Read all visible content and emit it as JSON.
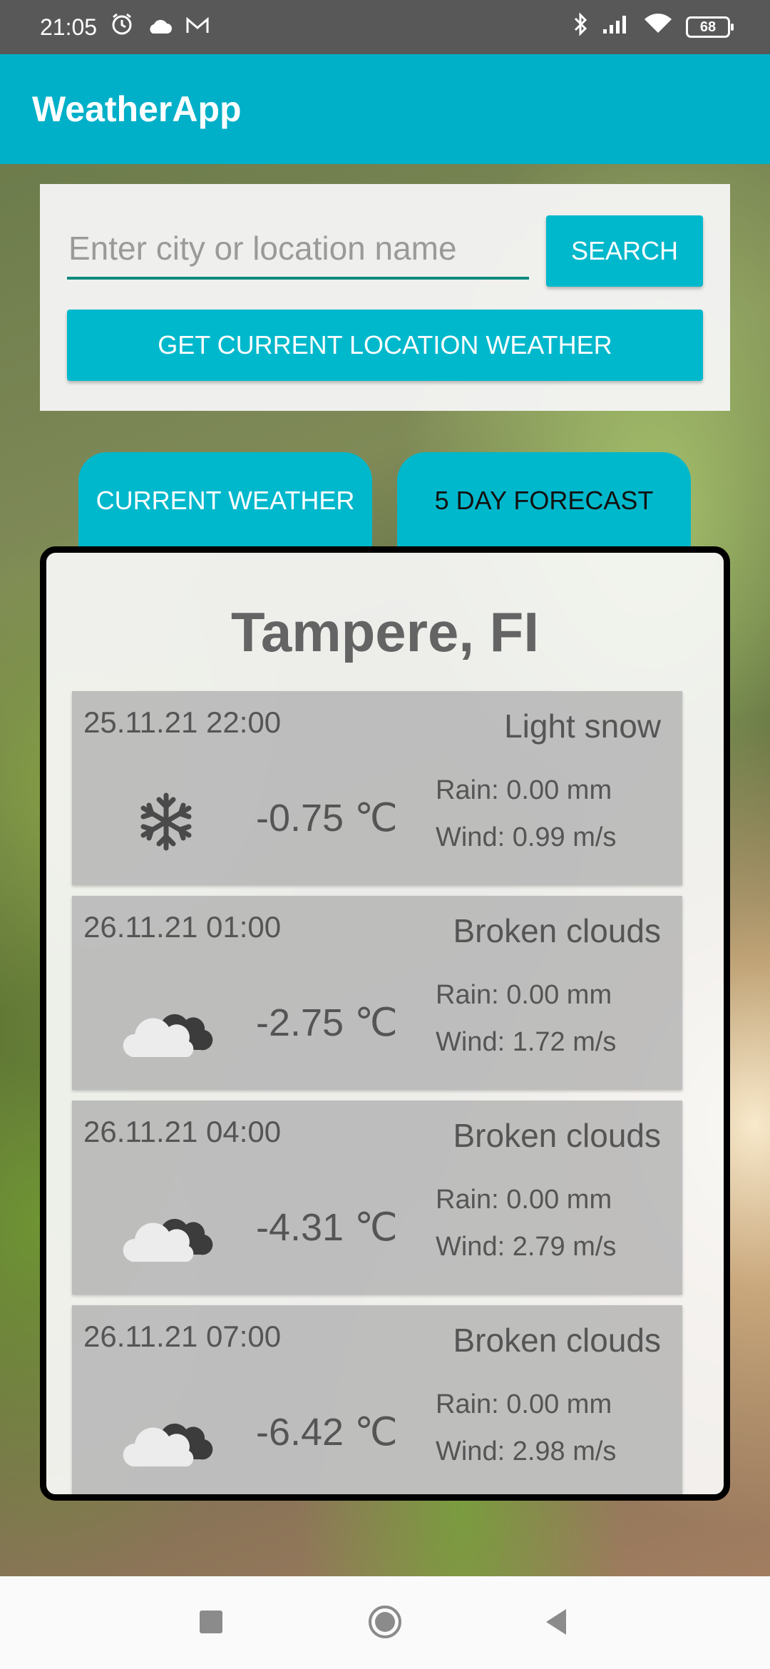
{
  "status_bar": {
    "time": "21:05",
    "battery": "68",
    "icons": [
      "alarm-icon",
      "cloud-icon",
      "mail-icon",
      "bluetooth-icon",
      "signal-icon",
      "wifi-icon",
      "battery-icon"
    ]
  },
  "app_bar": {
    "title": "WeatherApp"
  },
  "search": {
    "placeholder": "Enter city or location name",
    "button_label": "SEARCH",
    "location_button_label": "GET CURRENT LOCATION WEATHER"
  },
  "tabs": [
    {
      "label": "CURRENT WEATHER"
    },
    {
      "label": "5 DAY FORECAST",
      "selected": true
    }
  ],
  "forecast": {
    "city": "Tampere, FI",
    "items": [
      {
        "time": "25.11.21 22:00",
        "description": "Light snow",
        "temperature": "-0.75 ℃",
        "rain": "Rain: 0.00 mm",
        "wind": "Wind: 0.99 m/s",
        "icon": "snowflake-icon"
      },
      {
        "time": "26.11.21 01:00",
        "description": "Broken clouds",
        "temperature": "-2.75 ℃",
        "rain": "Rain: 0.00 mm",
        "wind": "Wind: 1.72 m/s",
        "icon": "broken-clouds-icon"
      },
      {
        "time": "26.11.21 04:00",
        "description": "Broken clouds",
        "temperature": "-4.31 ℃",
        "rain": "Rain: 0.00 mm",
        "wind": "Wind: 2.79 m/s",
        "icon": "broken-clouds-icon"
      },
      {
        "time": "26.11.21 07:00",
        "description": "Broken clouds",
        "temperature": "-6.42 ℃",
        "rain": "Rain: 0.00 mm",
        "wind": "Wind: 2.98 m/s",
        "icon": "broken-clouds-icon"
      }
    ]
  },
  "colors": {
    "accent": "#00b8cc",
    "app_bar": "#00b0c8",
    "input_underline": "#0f8a7e"
  }
}
